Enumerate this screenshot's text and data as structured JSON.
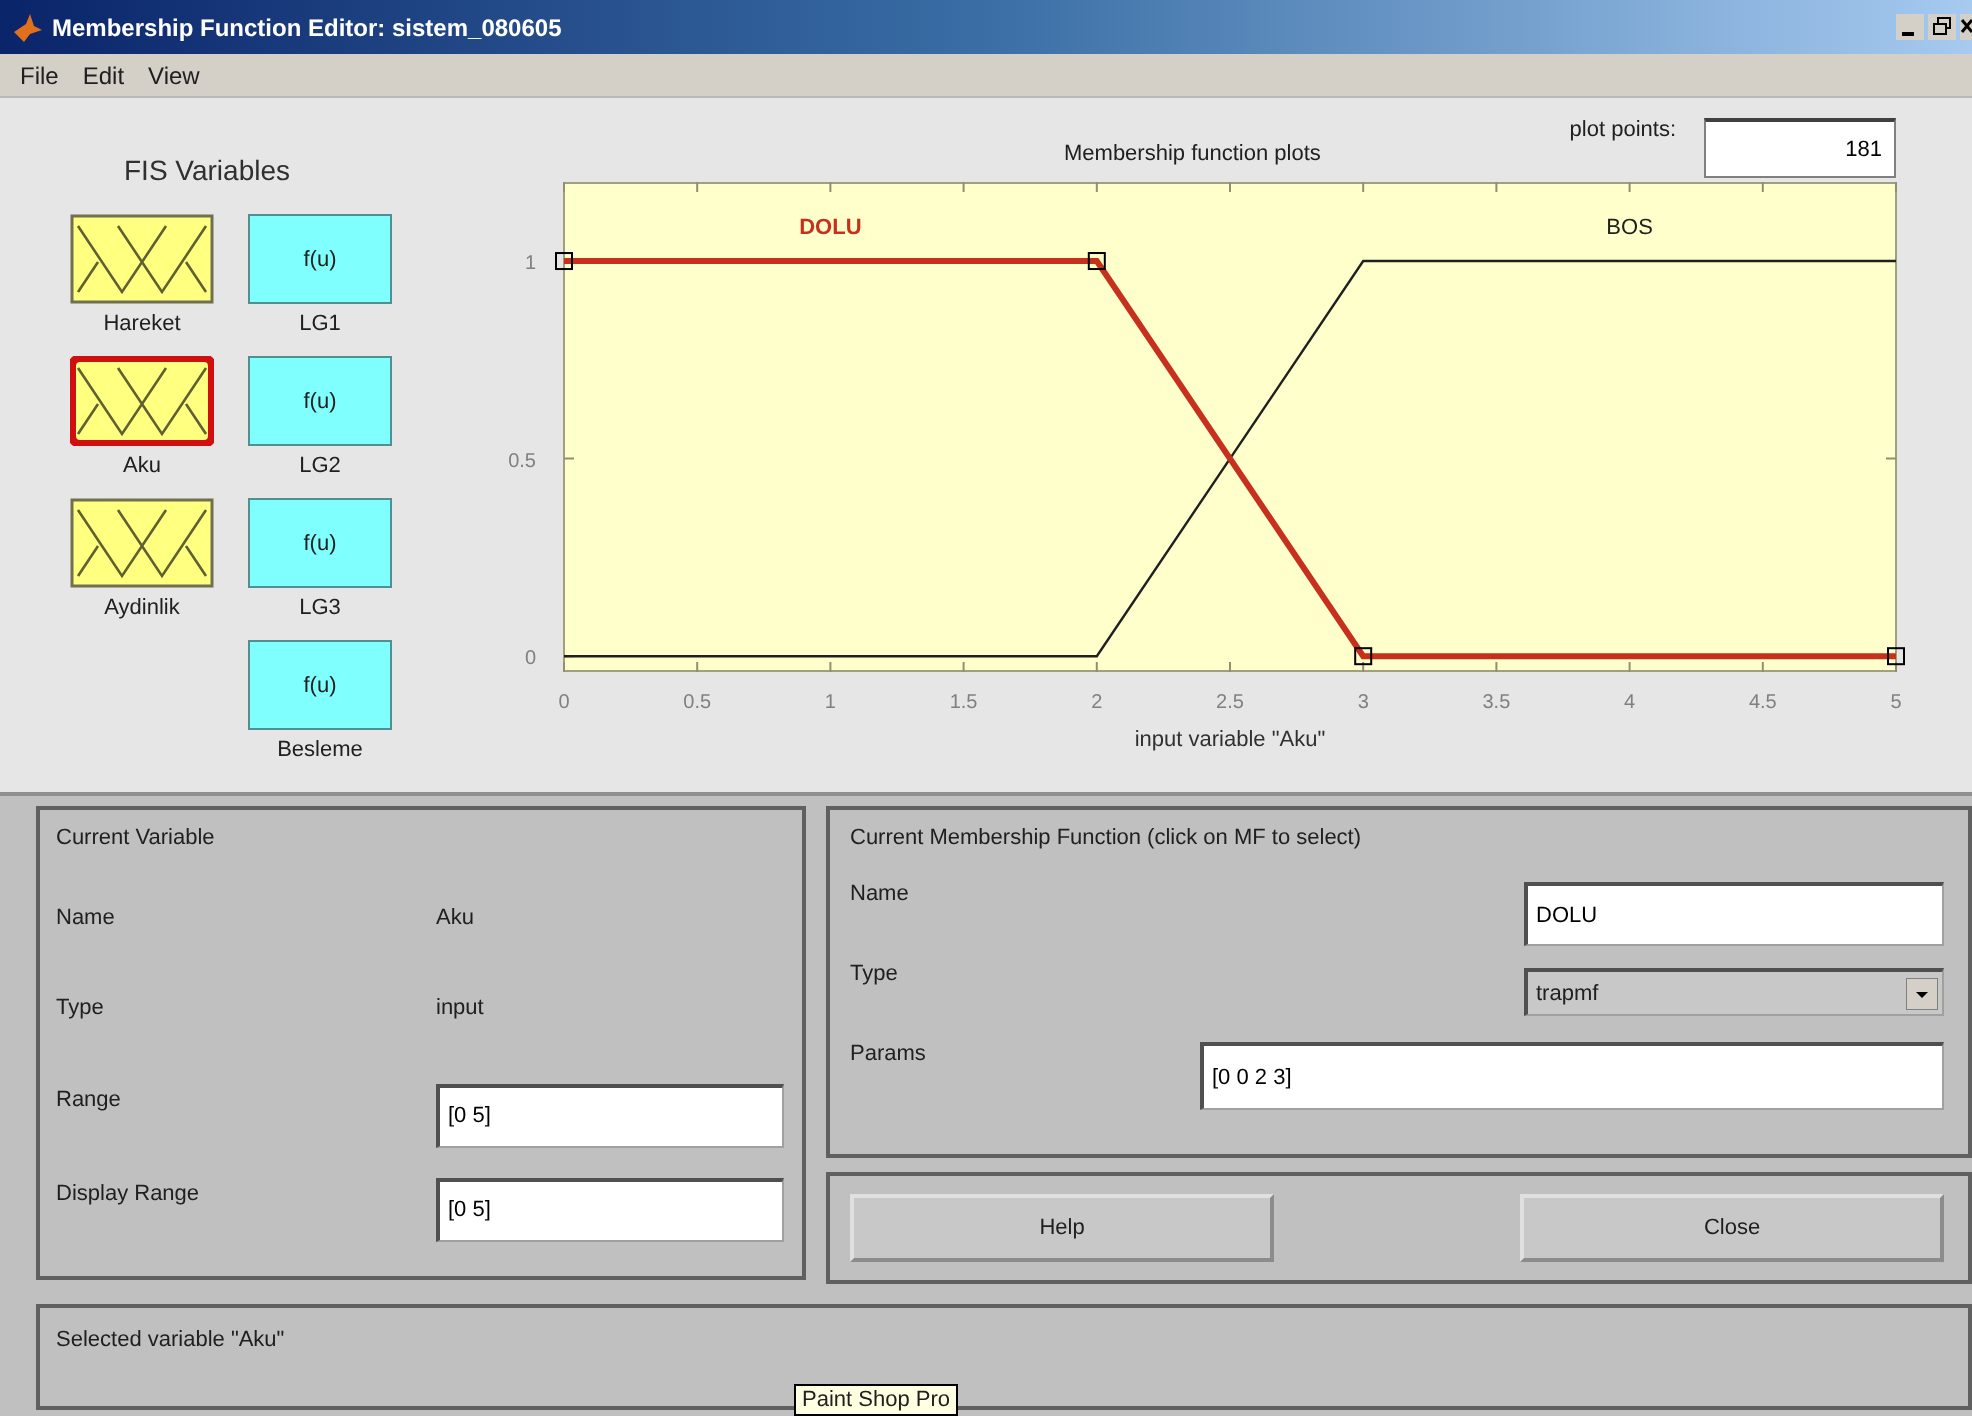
{
  "window": {
    "title": "Membership Function Editor: sistem_080605"
  },
  "menu": [
    "File",
    "Edit",
    "View"
  ],
  "fis_variables": {
    "title": "FIS Variables",
    "items": [
      {
        "kind": "input",
        "label": "Hareket",
        "selected": false
      },
      {
        "kind": "input",
        "label": "Aku",
        "selected": true
      },
      {
        "kind": "input",
        "label": "Aydinlik",
        "selected": false
      },
      {
        "kind": "output",
        "label": "LG1",
        "icon_text": "f(u)",
        "selected": false
      },
      {
        "kind": "output",
        "label": "LG2",
        "icon_text": "f(u)",
        "selected": false
      },
      {
        "kind": "output",
        "label": "LG3",
        "icon_text": "f(u)",
        "selected": false
      },
      {
        "kind": "output",
        "label": "Besleme",
        "icon_text": "f(u)",
        "selected": false
      }
    ]
  },
  "plot": {
    "plot_points_label": "plot points:",
    "plot_points": "181",
    "chart_data": {
      "type": "line",
      "title": "Membership function plots",
      "xlabel": "input variable \"Aku\"",
      "xlim": [
        0,
        5
      ],
      "ylim": [
        -0.04,
        1.2
      ],
      "xticks": [
        0,
        0.5,
        1,
        1.5,
        2,
        2.5,
        3,
        3.5,
        4,
        4.5,
        5
      ],
      "yticks": [
        0,
        0.5,
        1
      ],
      "x": [
        0,
        2,
        3,
        5
      ],
      "series": [
        {
          "name": "DOLU",
          "color": "#c8301e",
          "marker": "square",
          "values": [
            1,
            1,
            0,
            0
          ]
        },
        {
          "name": "BOS",
          "color": "#202020",
          "values": [
            0,
            0,
            1,
            1
          ]
        }
      ]
    }
  },
  "current_variable": {
    "title": "Current Variable",
    "name_label": "Name",
    "name": "Aku",
    "type_label": "Type",
    "type": "input",
    "range_label": "Range",
    "range": "[0 5]",
    "display_range_label": "Display Range",
    "display_range": "[0 5]"
  },
  "current_mf": {
    "title": "Current Membership Function (click on MF to select)",
    "name_label": "Name",
    "name": "DOLU",
    "type_label": "Type",
    "type": "trapmf",
    "params_label": "Params",
    "params": "[0 0 2 3]"
  },
  "buttons": [
    "Help",
    "Close"
  ],
  "status": "Selected variable \"Aku\"",
  "tooltip": "Paint Shop Pro"
}
